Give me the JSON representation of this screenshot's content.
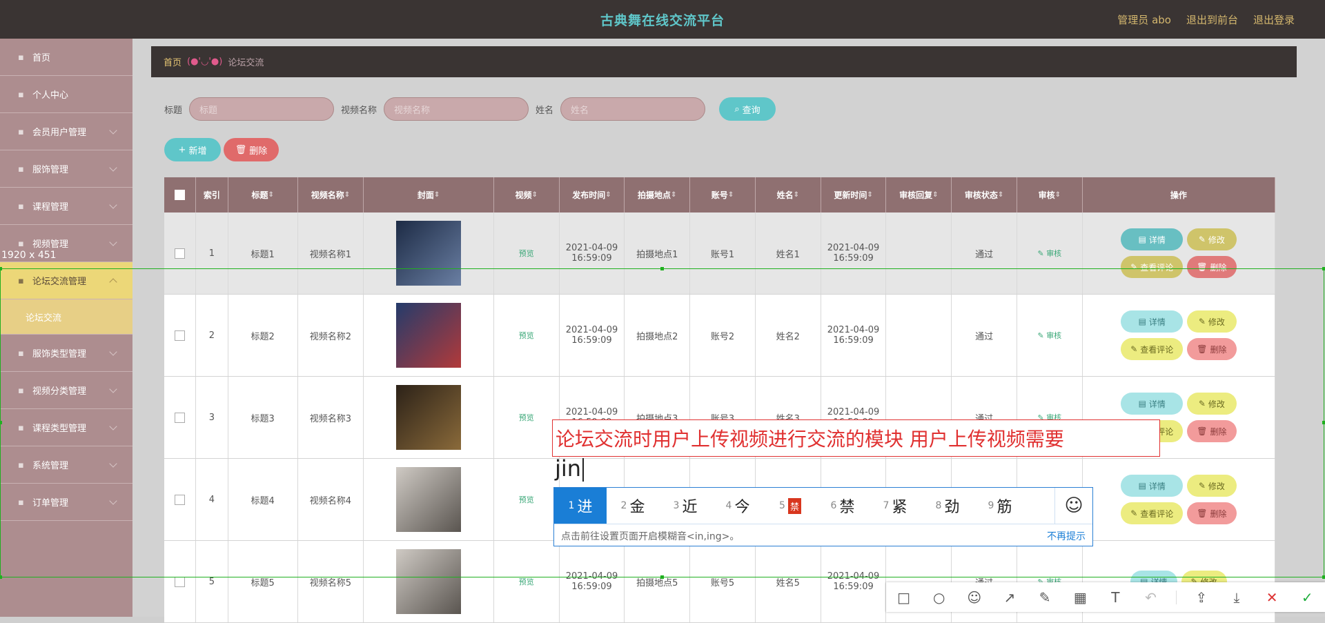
{
  "app": {
    "title": "古典舞在线交流平台",
    "admin": "管理员 abo",
    "to_front": "退出到前台",
    "logout": "退出登录"
  },
  "sidebar": {
    "items": [
      {
        "label": "首页"
      },
      {
        "label": "个人中心"
      },
      {
        "label": "会员用户管理"
      },
      {
        "label": "服饰管理"
      },
      {
        "label": "课程管理"
      },
      {
        "label": "视频管理"
      },
      {
        "label": "论坛交流管理"
      },
      {
        "label": "服饰类型管理"
      },
      {
        "label": "视频分类管理"
      },
      {
        "label": "课程类型管理"
      },
      {
        "label": "系统管理"
      },
      {
        "label": "订单管理"
      }
    ],
    "sub_item": "论坛交流"
  },
  "breadcrumb": {
    "home": "首页",
    "face": "(●'◡'●)",
    "current": "论坛交流"
  },
  "search": {
    "title_label": "标题",
    "title_placeholder": "标题",
    "video_label": "视频名称",
    "video_placeholder": "视频名称",
    "name_label": "姓名",
    "name_placeholder": "姓名",
    "query": "查询"
  },
  "actions": {
    "add": "新增",
    "delete": "删除"
  },
  "table": {
    "headers": [
      "索引",
      "标题",
      "视频名称",
      "封面",
      "视频",
      "发布时间",
      "拍摄地点",
      "账号",
      "姓名",
      "更新时间",
      "审核回复",
      "审核状态",
      "审核",
      "操作"
    ],
    "rows": [
      {
        "idx": "1",
        "title": "标题1",
        "video": "视频名称1",
        "preview": "预览",
        "pub_date": "2021-04-09",
        "pub_time": "16:59:09",
        "loc": "拍摄地点1",
        "acc": "账号1",
        "name": "姓名1",
        "up_date": "2021-04-09",
        "up_time": "16:59:09",
        "status": "通过",
        "audit": "审核"
      },
      {
        "idx": "2",
        "title": "标题2",
        "video": "视频名称2",
        "preview": "预览",
        "pub_date": "2021-04-09",
        "pub_time": "16:59:09",
        "loc": "拍摄地点2",
        "acc": "账号2",
        "name": "姓名2",
        "up_date": "2021-04-09",
        "up_time": "16:59:09",
        "status": "通过",
        "audit": "审核"
      },
      {
        "idx": "3",
        "title": "标题3",
        "video": "视频名称3",
        "preview": "预览",
        "pub_date": "2021-04-09",
        "pub_time": "16:59:09",
        "loc": "拍摄地点3",
        "acc": "账号3",
        "name": "姓名3",
        "up_date": "2021-04-09",
        "up_time": "16:59:09",
        "status": "通过",
        "audit": "审核"
      },
      {
        "idx": "4",
        "title": "标题4",
        "video": "视频名称4",
        "preview": "预览",
        "pub_date": "",
        "pub_time": "",
        "loc": "",
        "acc": "",
        "name": "",
        "up_date": "",
        "up_time": "",
        "status": "",
        "audit": ""
      },
      {
        "idx": "5",
        "title": "标题5",
        "video": "视频名称5",
        "preview": "预览",
        "pub_date": "2021-04-09",
        "pub_time": "16:59:09",
        "loc": "拍摄地点5",
        "acc": "账号5",
        "name": "姓名5",
        "up_date": "2021-04-09",
        "up_time": "16:59:09",
        "status": "通过",
        "audit": "审核"
      }
    ],
    "ops": {
      "detail": "详情",
      "edit": "修改",
      "comments": "查看评论",
      "remove": "删除"
    }
  },
  "screenshot": {
    "size": "1920 x 451"
  },
  "ime": {
    "text": "论坛交流时用户上传视频进行交流的模块 用户上传视频需要",
    "composition": "jin",
    "candidates": [
      {
        "n": "1",
        "c": "进"
      },
      {
        "n": "2",
        "c": "金"
      },
      {
        "n": "3",
        "c": "近"
      },
      {
        "n": "4",
        "c": "今"
      },
      {
        "n": "5",
        "c": "禁"
      },
      {
        "n": "6",
        "c": "禁"
      },
      {
        "n": "7",
        "c": "紧"
      },
      {
        "n": "8",
        "c": "劲"
      },
      {
        "n": "9",
        "c": "筋"
      }
    ],
    "hint": "点击前往设置页面开启模糊音<in,ing>。",
    "no_more": "不再提示"
  },
  "colors": {
    "topbar": "#3a3433",
    "accent": "#5fc6c9",
    "sidebar": "#ad8d8f",
    "active": "#ecd778",
    "ime_blue": "#1a7ed6",
    "ime_red": "#e03030"
  }
}
